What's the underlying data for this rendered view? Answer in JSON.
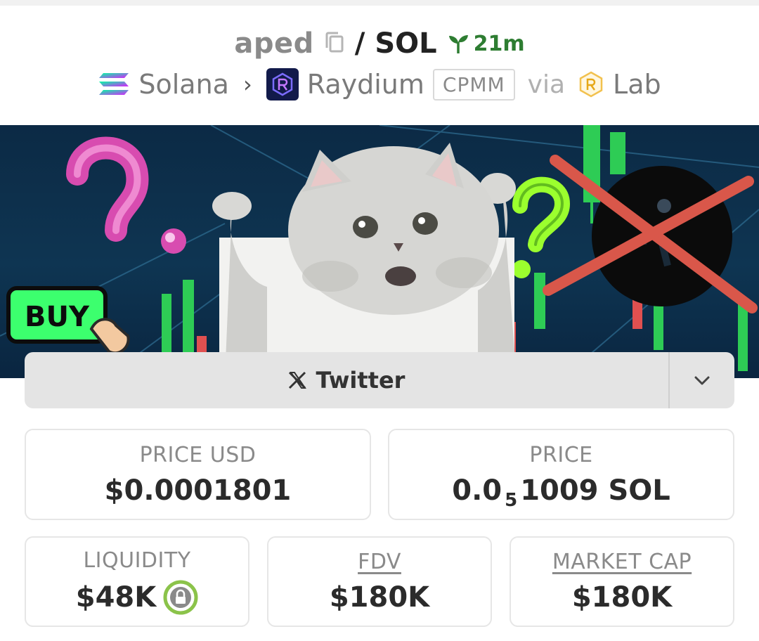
{
  "header": {
    "base_token": "aped",
    "separator": "/",
    "quote_token": "SOL",
    "age": "21m",
    "chain": "Solana",
    "dex": "Raydium",
    "pool_type": "CPMM",
    "via": "via",
    "launchpad": "Lab"
  },
  "social": {
    "twitter_label": "Twitter"
  },
  "stats": {
    "price_usd_label": "PRICE USD",
    "price_usd_value": "$0.0001801",
    "price_label": "PRICE",
    "price_prefix": "0.0",
    "price_zeros": "5",
    "price_digits": "1009 SOL",
    "liquidity_label": "LIQUIDITY",
    "liquidity_value": "$48K",
    "fdv_label": "FDV",
    "fdv_value": "$180K",
    "mcap_label": "MARKET CAP",
    "mcap_value": "$180K"
  },
  "banner": {
    "buy_text": "BUY"
  },
  "colors": {
    "age_green": "#2e7d32",
    "lock_green": "#8bc34a",
    "banner_bg": "#0e3552"
  },
  "icons": [
    "copy-icon",
    "sprout-icon",
    "solana-logo",
    "chevron-right-icon",
    "raydium-logo",
    "lab-logo",
    "x-logo-icon",
    "chevron-down-icon",
    "lock-icon"
  ]
}
